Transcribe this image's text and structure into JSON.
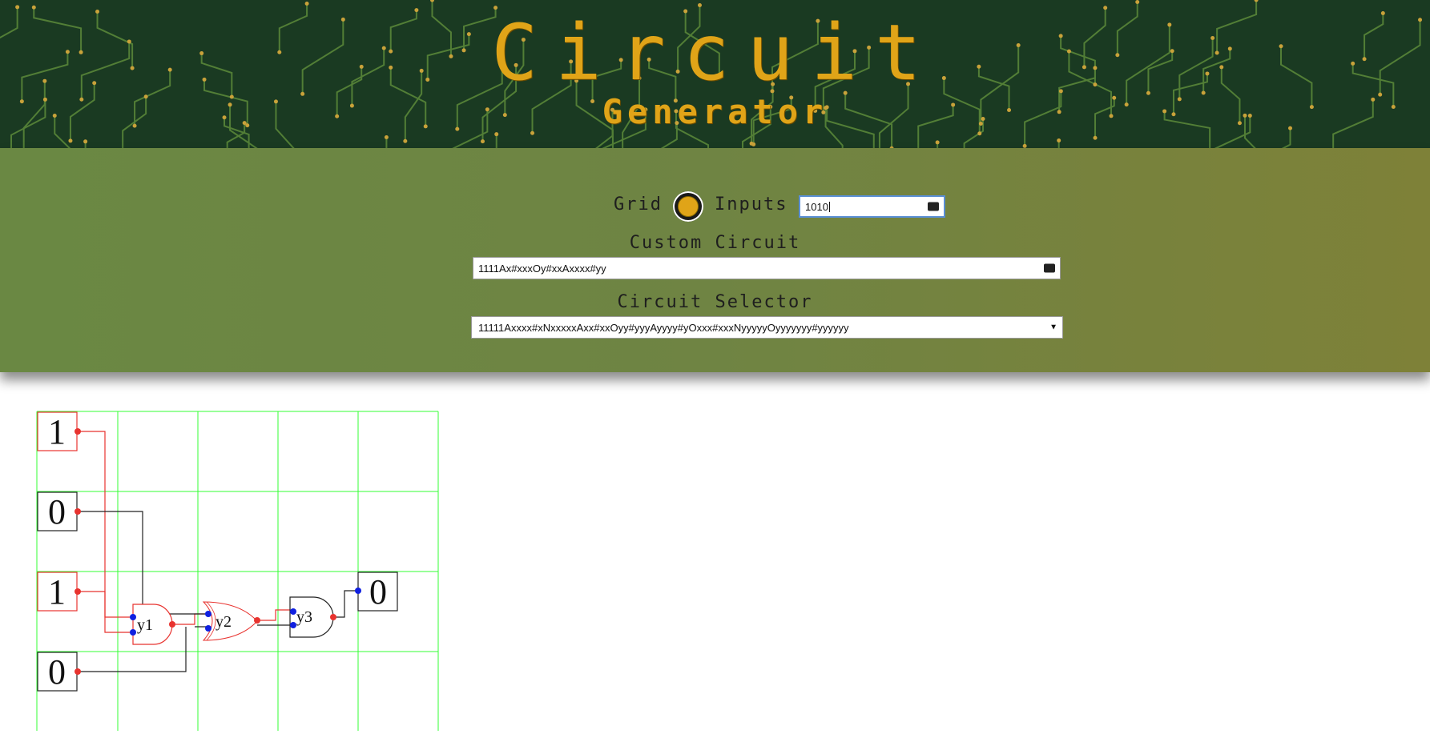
{
  "header": {
    "title": "Circuit",
    "subtitle": "Generator"
  },
  "controls": {
    "grid_label": "Grid",
    "inputs_label": "Inputs",
    "inputs_value": "1010",
    "custom_circuit_label": "Custom Circuit",
    "custom_circuit_value": "1111Ax#xxxOy#xxAxxxx#yy",
    "circuit_selector_label": "Circuit Selector",
    "circuit_selector_value": "11111Axxxx#xNxxxxxAxx#xxOyy#yyyAyyyy#yOxxx#xxxNyyyyyOyyyyyyy#yyyyyy"
  },
  "circuit": {
    "inputs": [
      "1",
      "0",
      "1",
      "0"
    ],
    "gates": [
      {
        "label": "y1",
        "type": "AND",
        "state": "active"
      },
      {
        "label": "y2",
        "type": "OR",
        "state": "active"
      },
      {
        "label": "y3",
        "type": "AND",
        "state": "inactive"
      }
    ],
    "output": "0",
    "colors": {
      "grid": "#33ff33",
      "active": "#e8332f",
      "inactive": "#222222",
      "pin_in": "#1020e0",
      "pin_out": "#e8332f"
    }
  },
  "icons": {
    "toggle": "radio-toggle-icon",
    "edit": "ellipsis-icon",
    "dropdown": "chevron-down-icon"
  }
}
